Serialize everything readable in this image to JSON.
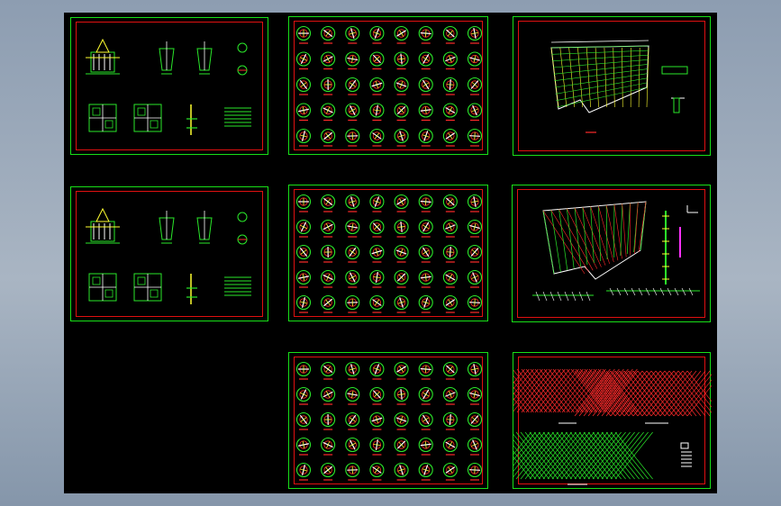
{
  "viewport": {
    "background": "#000000"
  },
  "colors": {
    "frame_outer": "#18e018",
    "frame_inner": "#e01010",
    "line_green": "#2ae82a",
    "line_red": "#ff2a2a",
    "line_yellow": "#ffff30",
    "line_white": "#ffffff",
    "line_magenta": "#ff30ff",
    "line_cyan": "#30c8ff"
  },
  "sheets": [
    {
      "id": "sheet-foundation-details-1",
      "kind": "details"
    },
    {
      "id": "sheet-node-details-1",
      "kind": "nodes",
      "rows": 5,
      "cols": 8
    },
    {
      "id": "sheet-plan-layout",
      "kind": "plan"
    },
    {
      "id": "sheet-foundation-details-2",
      "kind": "details"
    },
    {
      "id": "sheet-node-details-2",
      "kind": "nodes",
      "rows": 5,
      "cols": 8
    },
    {
      "id": "sheet-grid-layout",
      "kind": "grid"
    },
    {
      "id": "sheet-node-details-3",
      "kind": "nodes",
      "rows": 5,
      "cols": 8
    },
    {
      "id": "sheet-grid-color-layout",
      "kind": "colorgrid"
    }
  ]
}
